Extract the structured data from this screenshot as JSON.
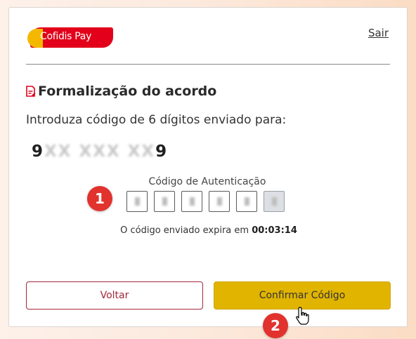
{
  "brand": {
    "logo_text": "Cofidis Pay",
    "primary_red": "#e2001a",
    "accent_yellow": "#f5b800"
  },
  "header": {
    "logout_label": "Sair"
  },
  "section": {
    "title": "Formalização do acordo",
    "title_icon": "document-edit-icon",
    "intro": "Introduza código de 6 dígitos enviado para:",
    "phone_visible_start": "9",
    "phone_masked_middle": "XX XXX XX",
    "phone_visible_end": "9"
  },
  "auth_code": {
    "label": "Código de Autenticação",
    "digit_count": 6
  },
  "expiry": {
    "prefix": "O código enviado expira em",
    "time": "00:03:14"
  },
  "buttons": {
    "back_label": "Voltar",
    "confirm_label": "Confirmar Código",
    "confirm_color": "#e1b400"
  },
  "annotations": {
    "step1": "1",
    "step2": "2",
    "badge_color": "#e2322d"
  }
}
